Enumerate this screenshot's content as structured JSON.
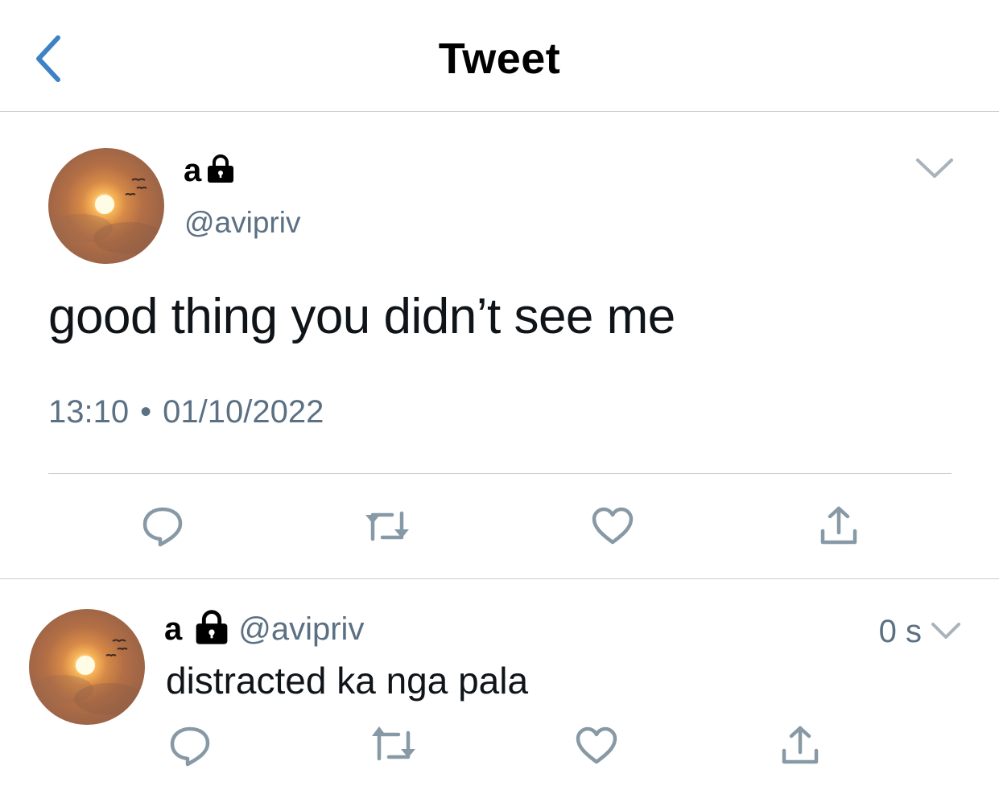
{
  "header": {
    "title": "Tweet",
    "back_icon": "chevron-left-icon"
  },
  "main_tweet": {
    "display_name": "a",
    "protected_icon": "lock-icon",
    "handle": "@avipriv",
    "text": "good thing you didn’t see me",
    "time": "13:10",
    "separator": "•",
    "date": "01/10/2022",
    "menu_icon": "chevron-down-icon",
    "actions": [
      "reply-icon",
      "retweet-icon",
      "like-icon",
      "share-icon"
    ]
  },
  "reply": {
    "display_name": "a",
    "protected_icon": "lock-icon",
    "handle": "@avipriv",
    "time": "0 s",
    "text": "distracted ka nga pala",
    "menu_icon": "chevron-down-icon",
    "actions": [
      "reply-icon",
      "retweet-icon",
      "like-icon",
      "share-icon"
    ]
  },
  "colors": {
    "accent": "#3d82c4",
    "secondary_text": "#5b7083",
    "icon_gray": "#8899a6",
    "divider": "#c8cbcf"
  }
}
